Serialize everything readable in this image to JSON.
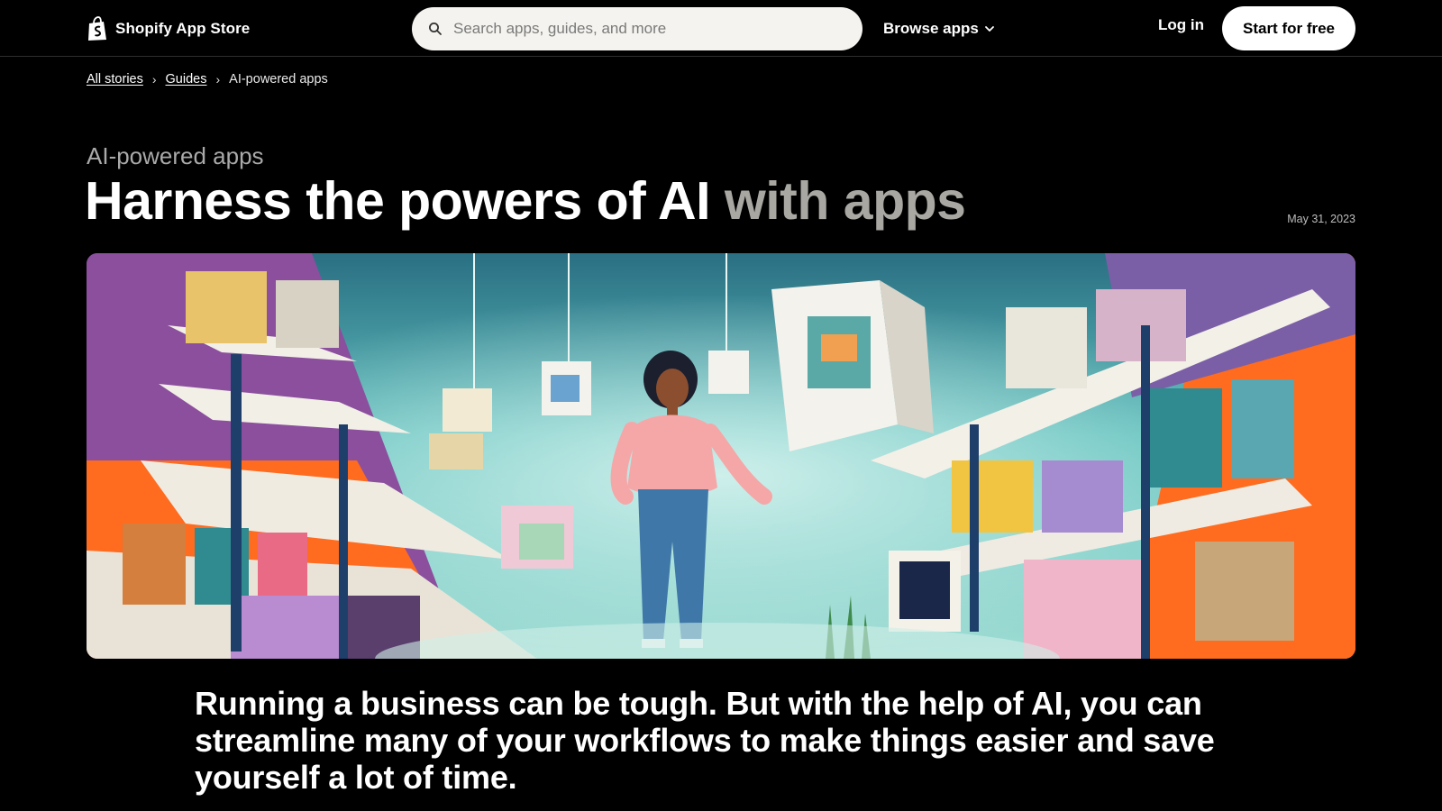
{
  "header": {
    "brand_name": "Shopify App Store",
    "search_placeholder": "Search apps, guides, and more",
    "browse_label": "Browse apps",
    "login_label": "Log in",
    "cta_label": "Start for free"
  },
  "breadcrumb": {
    "items": [
      "All stories",
      "Guides"
    ],
    "current": "AI-powered apps",
    "separator": "›"
  },
  "article": {
    "eyebrow": "AI-powered apps",
    "title_main": "Harness the powers of AI",
    "title_dim": "with apps",
    "date": "May 31, 2023",
    "lead": "Running a business can be tough. But with the help of AI, you can streamline many of your workflows to make things easier and save yourself a lot of time."
  },
  "icons": {
    "brand": "shopify-bag-icon",
    "search": "search-icon",
    "browse": "chevron-down-icon"
  },
  "colors": {
    "background": "#000000",
    "title_dim": "#a8a7a2",
    "cta_bg": "#ffffff",
    "search_bg": "#f4f3ef",
    "hero_orange": "#ff6b1f",
    "hero_teal": "#5fc0bd"
  }
}
